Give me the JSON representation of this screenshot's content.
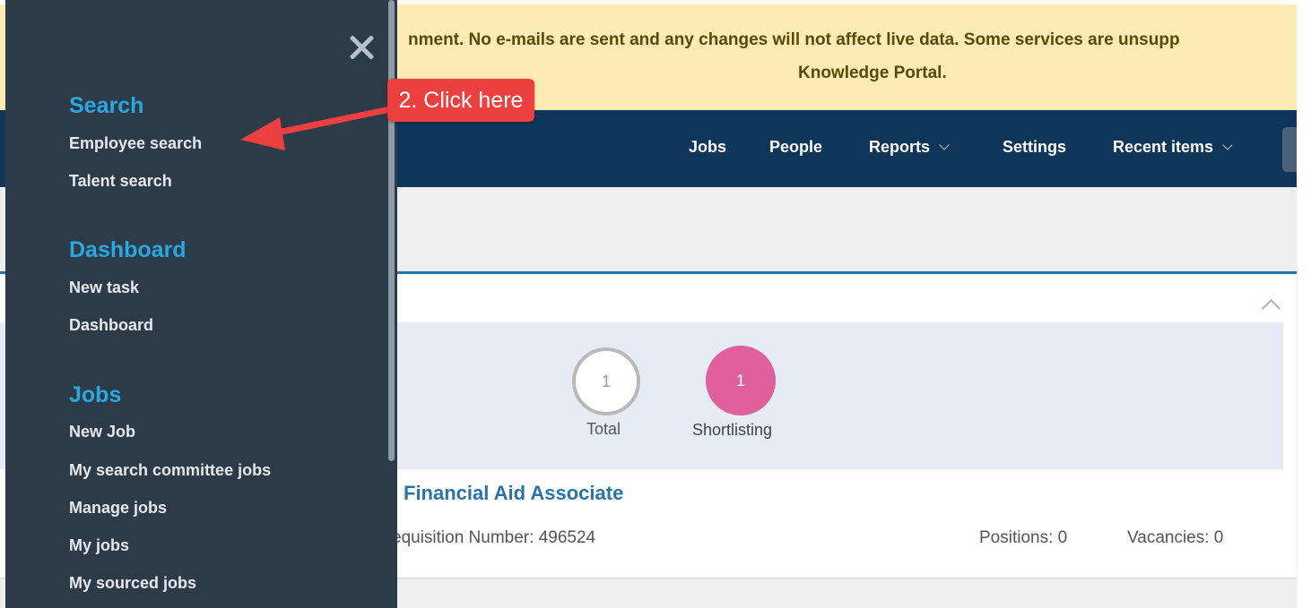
{
  "banner": {
    "line1": "nment. No e-mails are sent and any changes will not affect live data. Some services are unsupp",
    "line2": "Knowledge Portal."
  },
  "nav": {
    "items": [
      {
        "label": "Jobs",
        "has_dropdown": false
      },
      {
        "label": "People",
        "has_dropdown": false
      },
      {
        "label": "Reports",
        "has_dropdown": true
      },
      {
        "label": "Settings",
        "has_dropdown": false
      },
      {
        "label": "Recent items",
        "has_dropdown": true
      }
    ]
  },
  "stats": {
    "total": {
      "value": "1",
      "label": "Total"
    },
    "shortlisting": {
      "value": "1",
      "label": "Shortlisting"
    }
  },
  "job": {
    "title": "Financial Aid Associate",
    "requisition": "equisition Number: 496524",
    "positions": "Positions: 0",
    "vacancies": "Vacancies: 0"
  },
  "sidemenu": {
    "sections": [
      {
        "heading": "Search",
        "items": [
          "Employee search",
          "Talent search"
        ]
      },
      {
        "heading": "Dashboard",
        "items": [
          "New task",
          "Dashboard"
        ]
      },
      {
        "heading": "Jobs",
        "items": [
          "New Job",
          "My search committee jobs",
          "Manage jobs",
          "My jobs",
          "My sourced jobs"
        ]
      }
    ]
  },
  "annotation": {
    "label": "2. Click here"
  },
  "colors": {
    "menu_bg": "#2d3b49",
    "menu_heading": "#2aa7df",
    "navbar_bg": "#0f3559",
    "banner_bg": "#fcebb5",
    "callout_bg": "#ec3f3f",
    "shortlisting_circle": "#e0609c"
  }
}
